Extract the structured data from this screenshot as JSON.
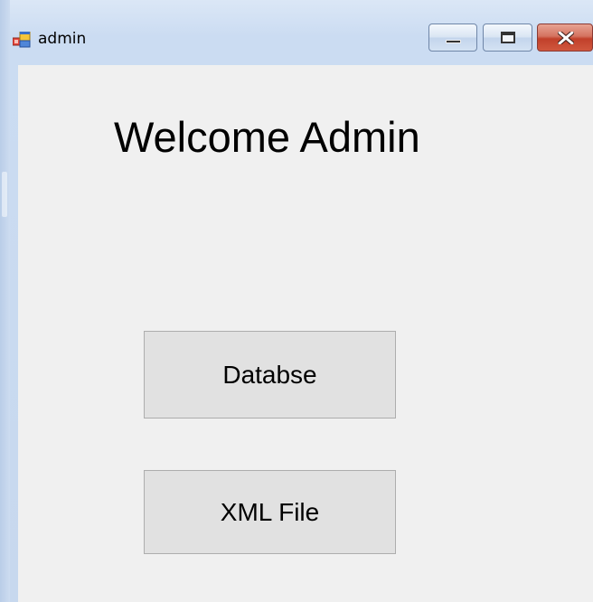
{
  "window": {
    "title": "admin",
    "app_icon": "windows-form-icon",
    "controls": {
      "minimize_icon": "minimize-icon",
      "maximize_icon": "maximize-icon",
      "close_icon": "close-icon"
    }
  },
  "main": {
    "heading": "Welcome Admin",
    "buttons": [
      {
        "label": "Databse"
      },
      {
        "label": "XML File"
      }
    ]
  },
  "colors": {
    "client_background": "#f0f0f0",
    "button_face": "#e1e1e1",
    "button_border": "#adadad",
    "close_button": "#c7503a"
  }
}
